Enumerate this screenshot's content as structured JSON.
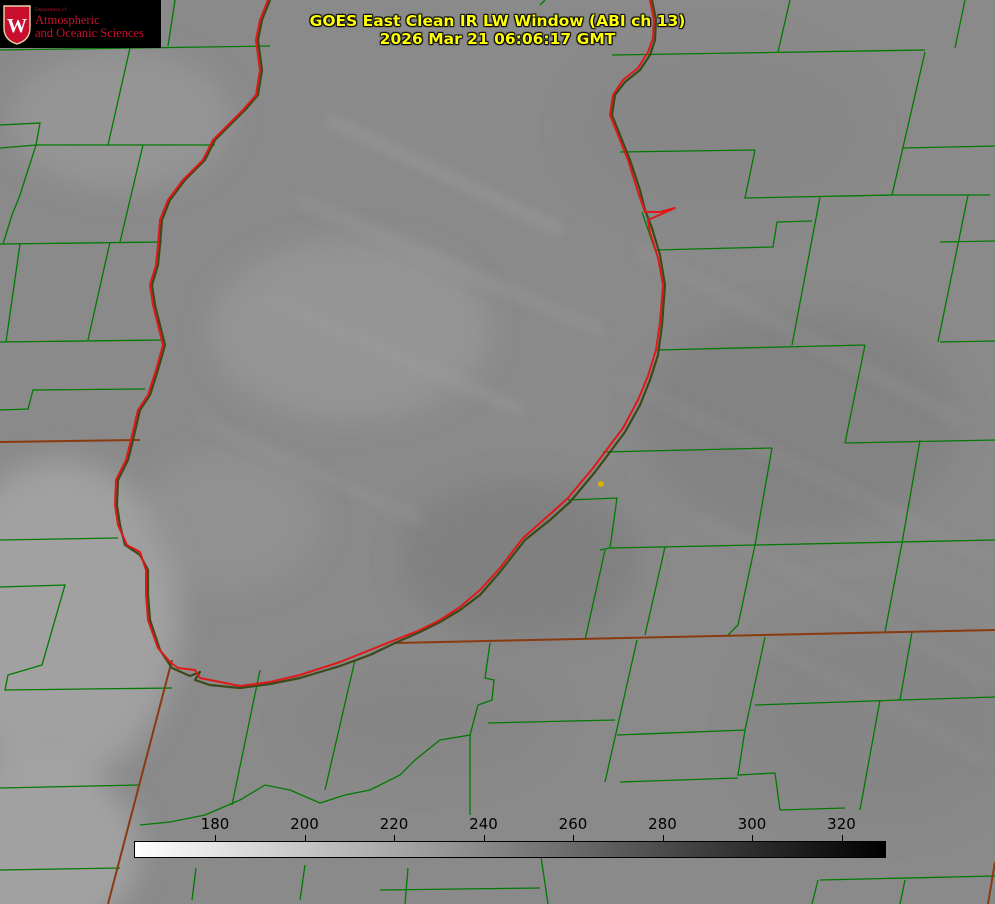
{
  "header": {
    "title_line1": "GOES East Clean IR LW Window (ABI ch 13)",
    "title_line2": "2026 Mar 21 06:06:17 GMT",
    "title_color": "#ffff00"
  },
  "logo": {
    "crest_letter": "W",
    "department_line": "Department of",
    "name_line1": "Atmospheric",
    "name_line2": "and Oceanic Sciences",
    "brand_color": "#c8102e"
  },
  "colorbar": {
    "tick_labels": [
      "180",
      "200",
      "220",
      "240",
      "260",
      "280",
      "300",
      "320"
    ],
    "gradient_start": "#ffffff",
    "gradient_end": "#000000"
  },
  "map": {
    "background_color": "#8a8a8a",
    "county_border_color": "#007a00",
    "lake_shoreline_color": "#e01818",
    "state_border_color": "#8a3a10",
    "marker_color": "#d4b000",
    "marker_icon": "station-dot-icon"
  }
}
